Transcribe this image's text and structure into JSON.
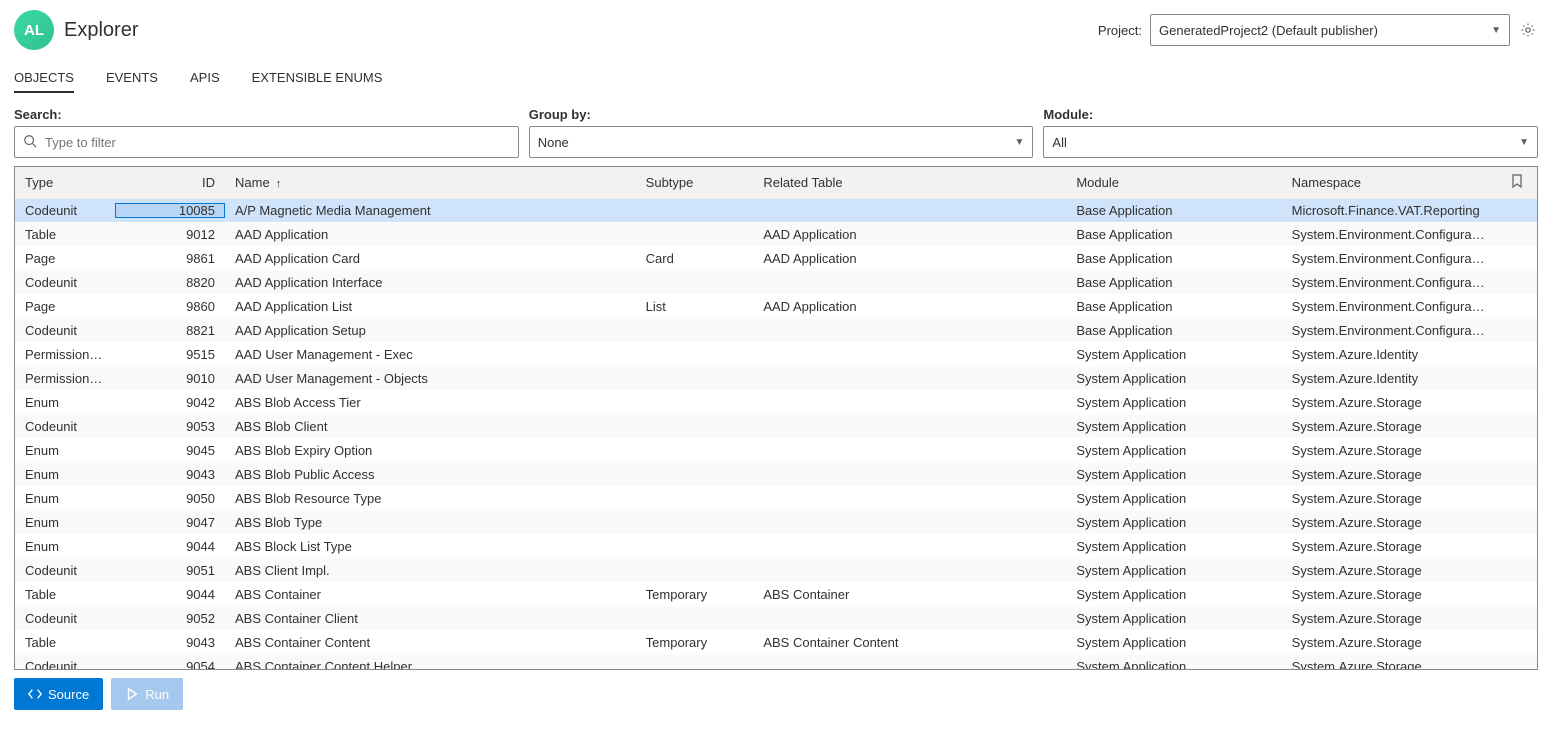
{
  "header": {
    "logo_text": "AL",
    "app_title": "Explorer",
    "project_label": "Project:",
    "project_value": "GeneratedProject2 (Default publisher)"
  },
  "tabs": [
    {
      "label": "OBJECTS",
      "active": true
    },
    {
      "label": "EVENTS",
      "active": false
    },
    {
      "label": "APIS",
      "active": false
    },
    {
      "label": "EXTENSIBLE ENUMS",
      "active": false
    }
  ],
  "filters": {
    "search_label": "Search:",
    "search_placeholder": "Type to filter",
    "search_value": "",
    "groupby_label": "Group by:",
    "groupby_value": "None",
    "module_label": "Module:",
    "module_value": "All"
  },
  "columns": {
    "type": "Type",
    "id": "ID",
    "name": "Name",
    "subtype": "Subtype",
    "related": "Related Table",
    "module": "Module",
    "namespace": "Namespace"
  },
  "sort": {
    "column": "name",
    "direction": "asc"
  },
  "rows": [
    {
      "type": "Codeunit",
      "id": "10085",
      "name": "A/P Magnetic Media Management",
      "subtype": "",
      "related": "",
      "module": "Base Application",
      "namespace": "Microsoft.Finance.VAT.Reporting",
      "selected": true
    },
    {
      "type": "Table",
      "id": "9012",
      "name": "AAD Application",
      "subtype": "",
      "related": "AAD Application",
      "module": "Base Application",
      "namespace": "System.Environment.Configurati..."
    },
    {
      "type": "Page",
      "id": "9861",
      "name": "AAD Application Card",
      "subtype": "Card",
      "related": "AAD Application",
      "module": "Base Application",
      "namespace": "System.Environment.Configurati..."
    },
    {
      "type": "Codeunit",
      "id": "8820",
      "name": "AAD Application Interface",
      "subtype": "",
      "related": "",
      "module": "Base Application",
      "namespace": "System.Environment.Configurati..."
    },
    {
      "type": "Page",
      "id": "9860",
      "name": "AAD Application List",
      "subtype": "List",
      "related": "AAD Application",
      "module": "Base Application",
      "namespace": "System.Environment.Configurati..."
    },
    {
      "type": "Codeunit",
      "id": "8821",
      "name": "AAD Application Setup",
      "subtype": "",
      "related": "",
      "module": "Base Application",
      "namespace": "System.Environment.Configurati..."
    },
    {
      "type": "PermissionSet",
      "id": "9515",
      "name": "AAD User Management - Exec",
      "subtype": "",
      "related": "",
      "module": "System Application",
      "namespace": "System.Azure.Identity"
    },
    {
      "type": "PermissionSet",
      "id": "9010",
      "name": "AAD User Management - Objects",
      "subtype": "",
      "related": "",
      "module": "System Application",
      "namespace": "System.Azure.Identity"
    },
    {
      "type": "Enum",
      "id": "9042",
      "name": "ABS Blob Access Tier",
      "subtype": "",
      "related": "",
      "module": "System Application",
      "namespace": "System.Azure.Storage"
    },
    {
      "type": "Codeunit",
      "id": "9053",
      "name": "ABS Blob Client",
      "subtype": "",
      "related": "",
      "module": "System Application",
      "namespace": "System.Azure.Storage"
    },
    {
      "type": "Enum",
      "id": "9045",
      "name": "ABS Blob Expiry Option",
      "subtype": "",
      "related": "",
      "module": "System Application",
      "namespace": "System.Azure.Storage"
    },
    {
      "type": "Enum",
      "id": "9043",
      "name": "ABS Blob Public Access",
      "subtype": "",
      "related": "",
      "module": "System Application",
      "namespace": "System.Azure.Storage"
    },
    {
      "type": "Enum",
      "id": "9050",
      "name": "ABS Blob Resource Type",
      "subtype": "",
      "related": "",
      "module": "System Application",
      "namespace": "System.Azure.Storage"
    },
    {
      "type": "Enum",
      "id": "9047",
      "name": "ABS Blob Type",
      "subtype": "",
      "related": "",
      "module": "System Application",
      "namespace": "System.Azure.Storage"
    },
    {
      "type": "Enum",
      "id": "9044",
      "name": "ABS Block List Type",
      "subtype": "",
      "related": "",
      "module": "System Application",
      "namespace": "System.Azure.Storage"
    },
    {
      "type": "Codeunit",
      "id": "9051",
      "name": "ABS Client Impl.",
      "subtype": "",
      "related": "",
      "module": "System Application",
      "namespace": "System.Azure.Storage"
    },
    {
      "type": "Table",
      "id": "9044",
      "name": "ABS Container",
      "subtype": "Temporary",
      "related": "ABS Container",
      "module": "System Application",
      "namespace": "System.Azure.Storage"
    },
    {
      "type": "Codeunit",
      "id": "9052",
      "name": "ABS Container Client",
      "subtype": "",
      "related": "",
      "module": "System Application",
      "namespace": "System.Azure.Storage"
    },
    {
      "type": "Table",
      "id": "9043",
      "name": "ABS Container Content",
      "subtype": "Temporary",
      "related": "ABS Container Content",
      "module": "System Application",
      "namespace": "System.Azure.Storage"
    },
    {
      "type": "Codeunit",
      "id": "9054",
      "name": "ABS Container Content Helper",
      "subtype": "",
      "related": "",
      "module": "System Application",
      "namespace": "System.Azure.Storage"
    }
  ],
  "actions": {
    "source": "Source",
    "run": "Run"
  }
}
